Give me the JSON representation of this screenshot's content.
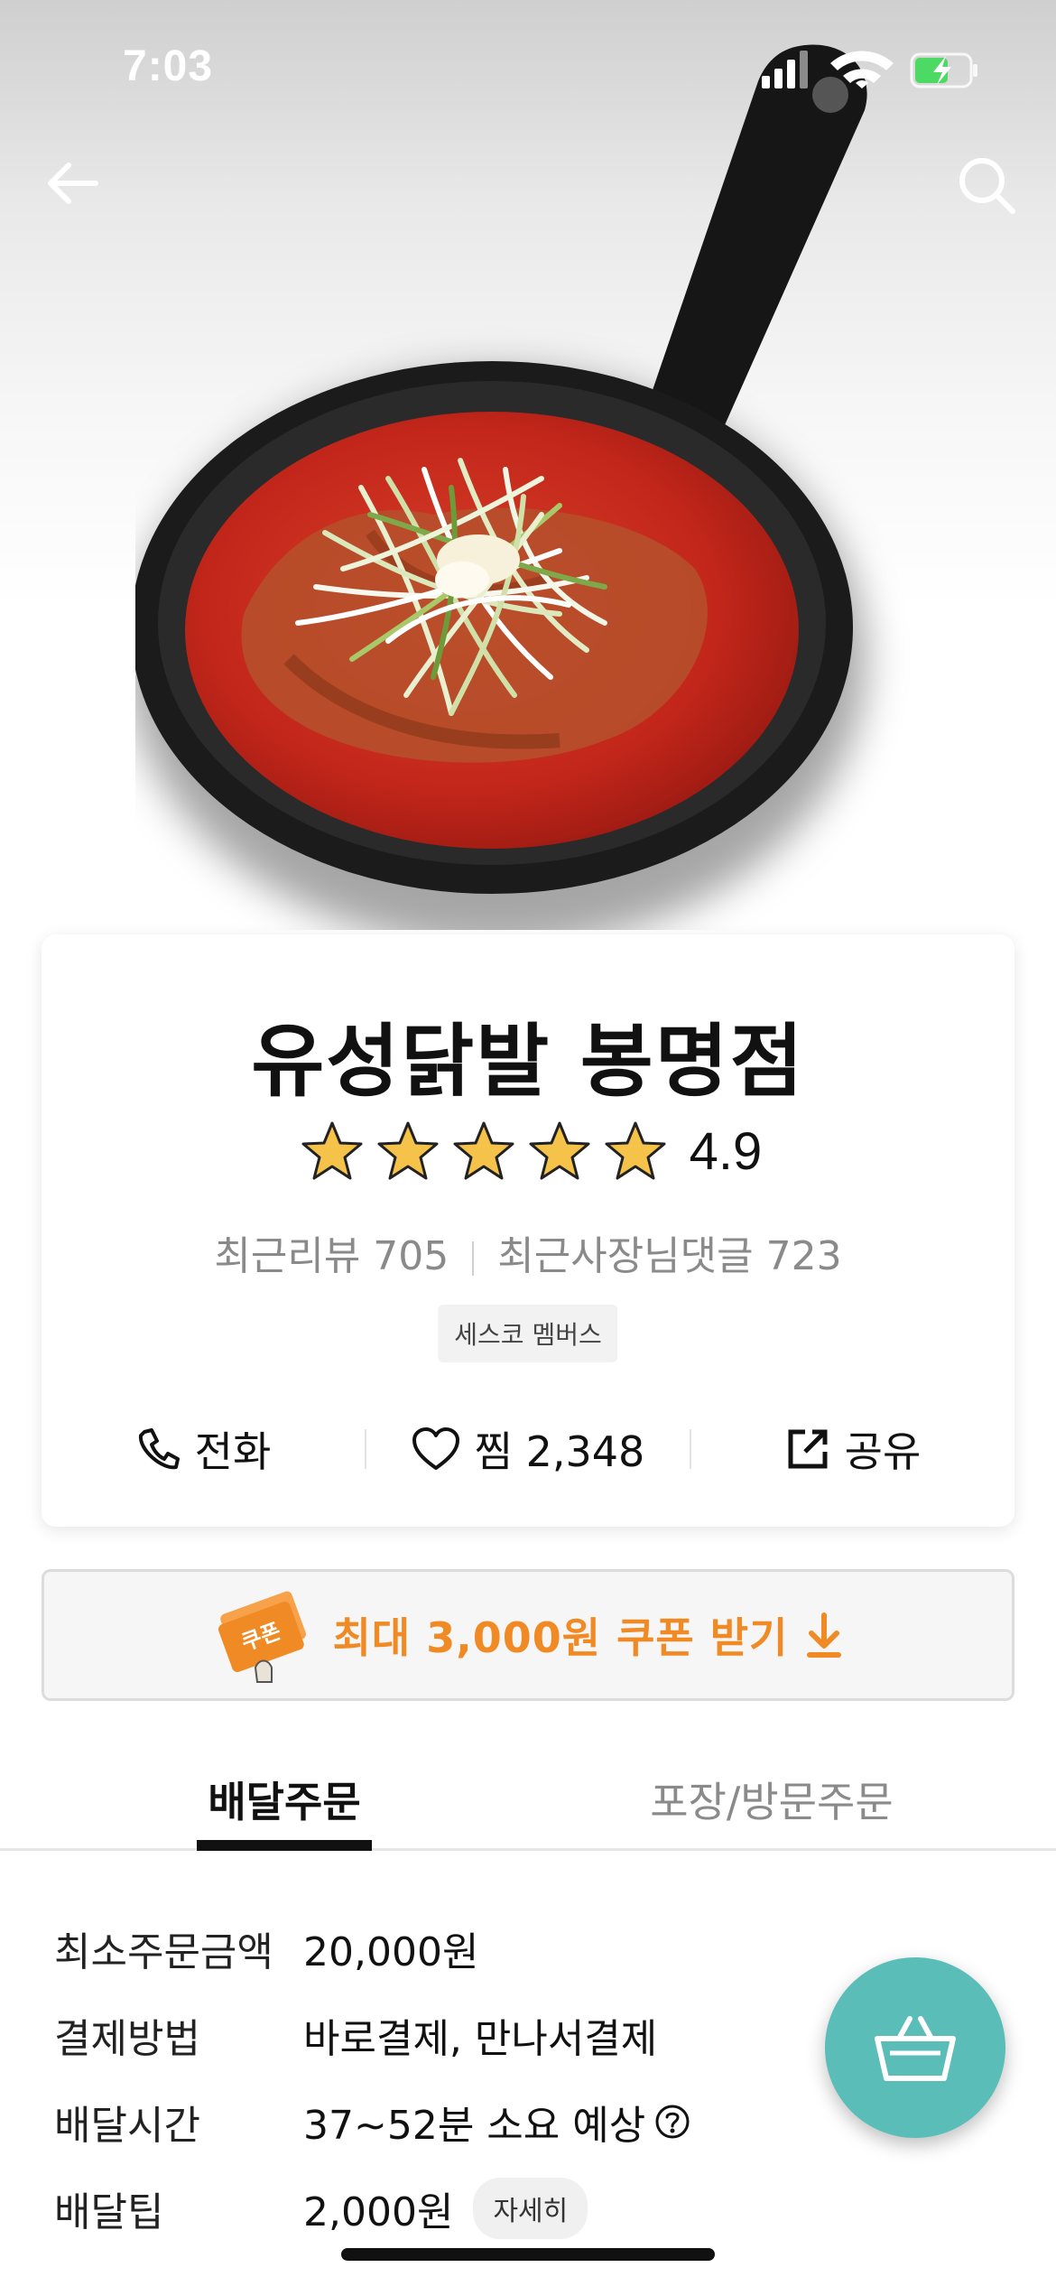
{
  "status_bar": {
    "time": "7:03"
  },
  "store": {
    "name": "유성닭발 봉명점",
    "rating": "4.9",
    "stars_filled": 5,
    "recent_reviews": "최근리뷰 705",
    "owner_replies": "최근사장님댓글 723",
    "badge": "세스코 멤버스"
  },
  "actions": {
    "call": "전화",
    "like": "찜 2,348",
    "share": "공유"
  },
  "coupon": {
    "label": "최대 3,000원 쿠폰 받기",
    "icon_text": "쿠폰"
  },
  "tabs": [
    {
      "label": "배달주문",
      "active": true
    },
    {
      "label": "포장/방문주문",
      "active": false
    }
  ],
  "delivery_info": {
    "min_order_label": "최소주문금액",
    "min_order_value": "20,000원",
    "payment_label": "결제방법",
    "payment_value": "바로결제, 만나서결제",
    "time_label": "배달시간",
    "time_value": "37~52분 소요 예상",
    "tip_label": "배달팁",
    "tip_value": "2,000원",
    "detail_button": "자세히"
  },
  "icons": {
    "back": "arrow-left-icon",
    "search": "search-icon",
    "call": "phone-icon",
    "like": "heart-icon",
    "share": "share-icon",
    "cart": "basket-icon"
  },
  "colors": {
    "accent_orange": "#f08a24",
    "cart_teal": "#5bbdb8",
    "star_gold": "#f5c24a"
  }
}
